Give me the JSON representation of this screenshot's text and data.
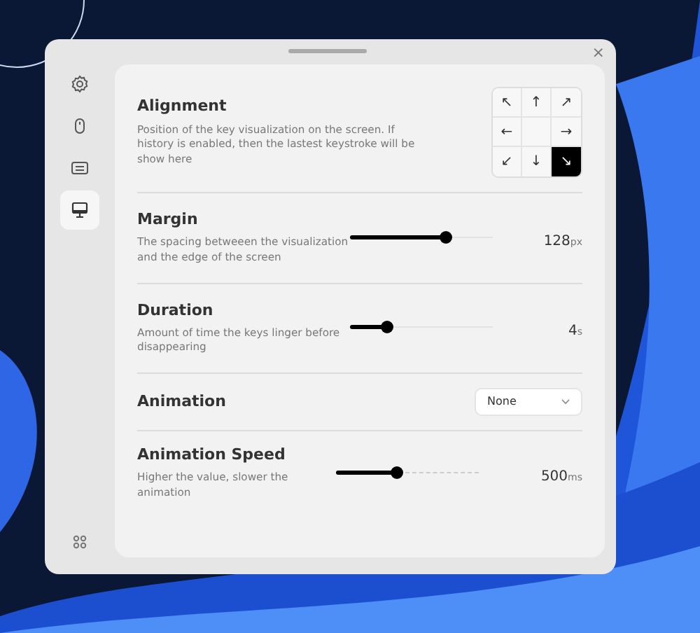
{
  "sidebar": {
    "items": [
      {
        "kind": "gear",
        "selected": false
      },
      {
        "kind": "mouse",
        "selected": false
      },
      {
        "kind": "keyboard",
        "selected": false
      },
      {
        "kind": "monitor",
        "selected": true
      }
    ]
  },
  "window": {
    "close": "×"
  },
  "settings": [
    {
      "kind": "alignment",
      "title": "Alignment",
      "description": "Position of the key visualization on the screen. If history is enabled, then the lastest keystroke will be show here",
      "cells": [
        {
          "arrow": "↖",
          "selected": false
        },
        {
          "arrow": "↑",
          "selected": false
        },
        {
          "arrow": "↗",
          "selected": false
        },
        {
          "arrow": "←",
          "selected": false
        },
        {
          "selected": false
        },
        {
          "arrow": "→",
          "selected": false
        },
        {
          "arrow": "↙",
          "selected": false
        },
        {
          "arrow": "↓",
          "selected": false
        },
        {
          "arrow": "↘",
          "selected": true
        }
      ]
    },
    {
      "kind": "slider",
      "title": "Margin",
      "description": "The spacing betweeen the visualization and the edge of the screen",
      "level": 0.67,
      "value": "128",
      "unit": "px"
    },
    {
      "kind": "slider",
      "title": "Duration",
      "description": "Amount of time the keys linger before disappearing",
      "level": 0.25,
      "value": "4",
      "unit": "s"
    },
    {
      "kind": "select",
      "title": "Animation",
      "value": "None"
    },
    {
      "kind": "dashed-slider",
      "title": "Animation Speed",
      "description": "Higher the value, slower the animation",
      "level": 0.42,
      "value": "500",
      "unit": "ms"
    }
  ]
}
